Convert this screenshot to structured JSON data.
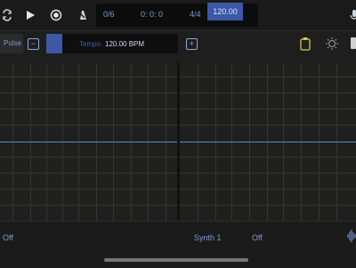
{
  "transport": {
    "counter_steps": "0/6",
    "counter_time": "0: 0: 0",
    "time_signature": "4/4",
    "bpm_value": "120.00"
  },
  "tempo_bar": {
    "pulse_label": "Pulse",
    "minus_label": "−",
    "plus_label": "+",
    "tempo_label": "Tempo",
    "tempo_value": "120.00 BPM"
  },
  "bottom": {
    "left_status": "Off",
    "instrument": "Synth 1",
    "right_status": "Off"
  },
  "colors": {
    "accent": "#8aa6de",
    "highlight": "#3c58a6",
    "waveform": "#5b87c8",
    "grid_line": "#343630"
  },
  "icons": [
    "loop-icon",
    "play-icon",
    "record-icon",
    "metronome-icon",
    "mic-icon",
    "clipboard-icon",
    "brightness-icon",
    "waveform-icon"
  ]
}
